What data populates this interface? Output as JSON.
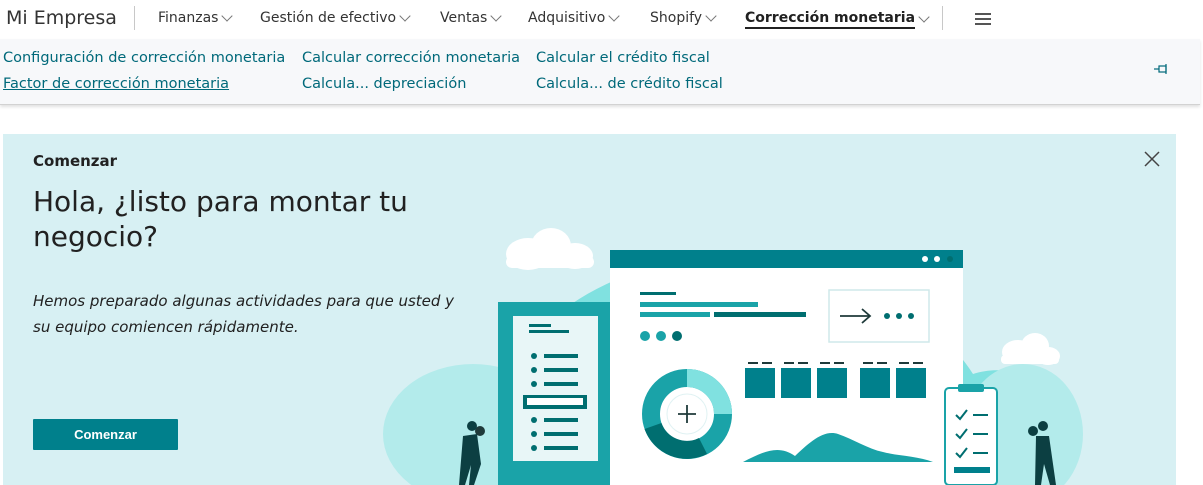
{
  "app": {
    "company": "Mi Empresa"
  },
  "nav": {
    "items": [
      {
        "label": "Finanzas"
      },
      {
        "label": "Gestión de efectivo"
      },
      {
        "label": "Ventas"
      },
      {
        "label": "Adquisitivo"
      },
      {
        "label": "Shopify"
      },
      {
        "label": "Corrección monetaria",
        "active": true
      }
    ],
    "menu_icon": "hamburger-icon"
  },
  "actions": {
    "col1": [
      "Configuración de corrección monetaria",
      "Factor de corrección monetaria"
    ],
    "col2": [
      "Calcular corrección monetaria",
      "Calcula... depreciación"
    ],
    "col3": [
      "Calcular el crédito fiscal",
      "Calcula... de crédito fiscal"
    ],
    "pin_icon": "pin-icon"
  },
  "banner": {
    "eyebrow": "Comenzar",
    "headline": "Hola, ¿listo para montar tu negocio?",
    "description": "Hemos preparado algunas actividades para que usted y su equipo comiencen rápidamente.",
    "cta_label": "Comenzar",
    "close_icon": "close-icon"
  },
  "colors": {
    "accent": "#00808c",
    "link": "#00697a",
    "banner_bg": "#d7f0f3",
    "illustration_light": "#80e1e0",
    "illustration_dark": "#006e70"
  }
}
